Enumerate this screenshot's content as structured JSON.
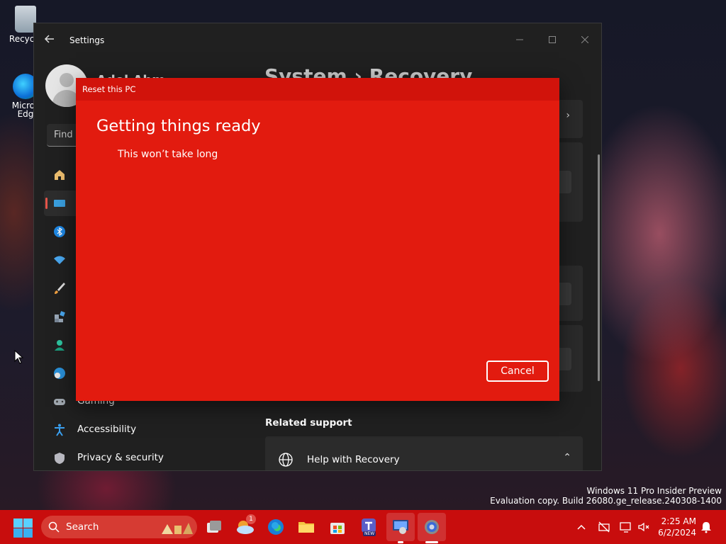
{
  "desktop": {
    "icons": [
      {
        "label": "Recycle"
      },
      {
        "label_line1": "Micros",
        "label_line2": "Edg"
      }
    ]
  },
  "settings_window": {
    "title": "Settings",
    "user_name": "Adel Ahm",
    "search_placeholder": "Find a",
    "breadcrumb": "System  ›  Recovery",
    "nav": {
      "gaming": "Gaming",
      "accessibility": "Accessibility",
      "privacy": "Privacy & security"
    },
    "related_support": "Related support",
    "help_card": "Help with Recovery"
  },
  "dialog": {
    "title": "Reset this PC",
    "heading": "Getting things ready",
    "subtext": "This won’t take long",
    "cancel": "Cancel",
    "background_color": "#e21b0f"
  },
  "watermark": {
    "line1": "Windows 11 Pro Insider Preview",
    "line2": "Evaluation copy. Build 26080.ge_release.240308-1400"
  },
  "taskbar": {
    "search_label": "Search",
    "weather_badge": "1",
    "teams_badge": "NEW",
    "time": "2:25 AM",
    "date": "6/2/2024",
    "accent_color": "#c80d0d"
  }
}
